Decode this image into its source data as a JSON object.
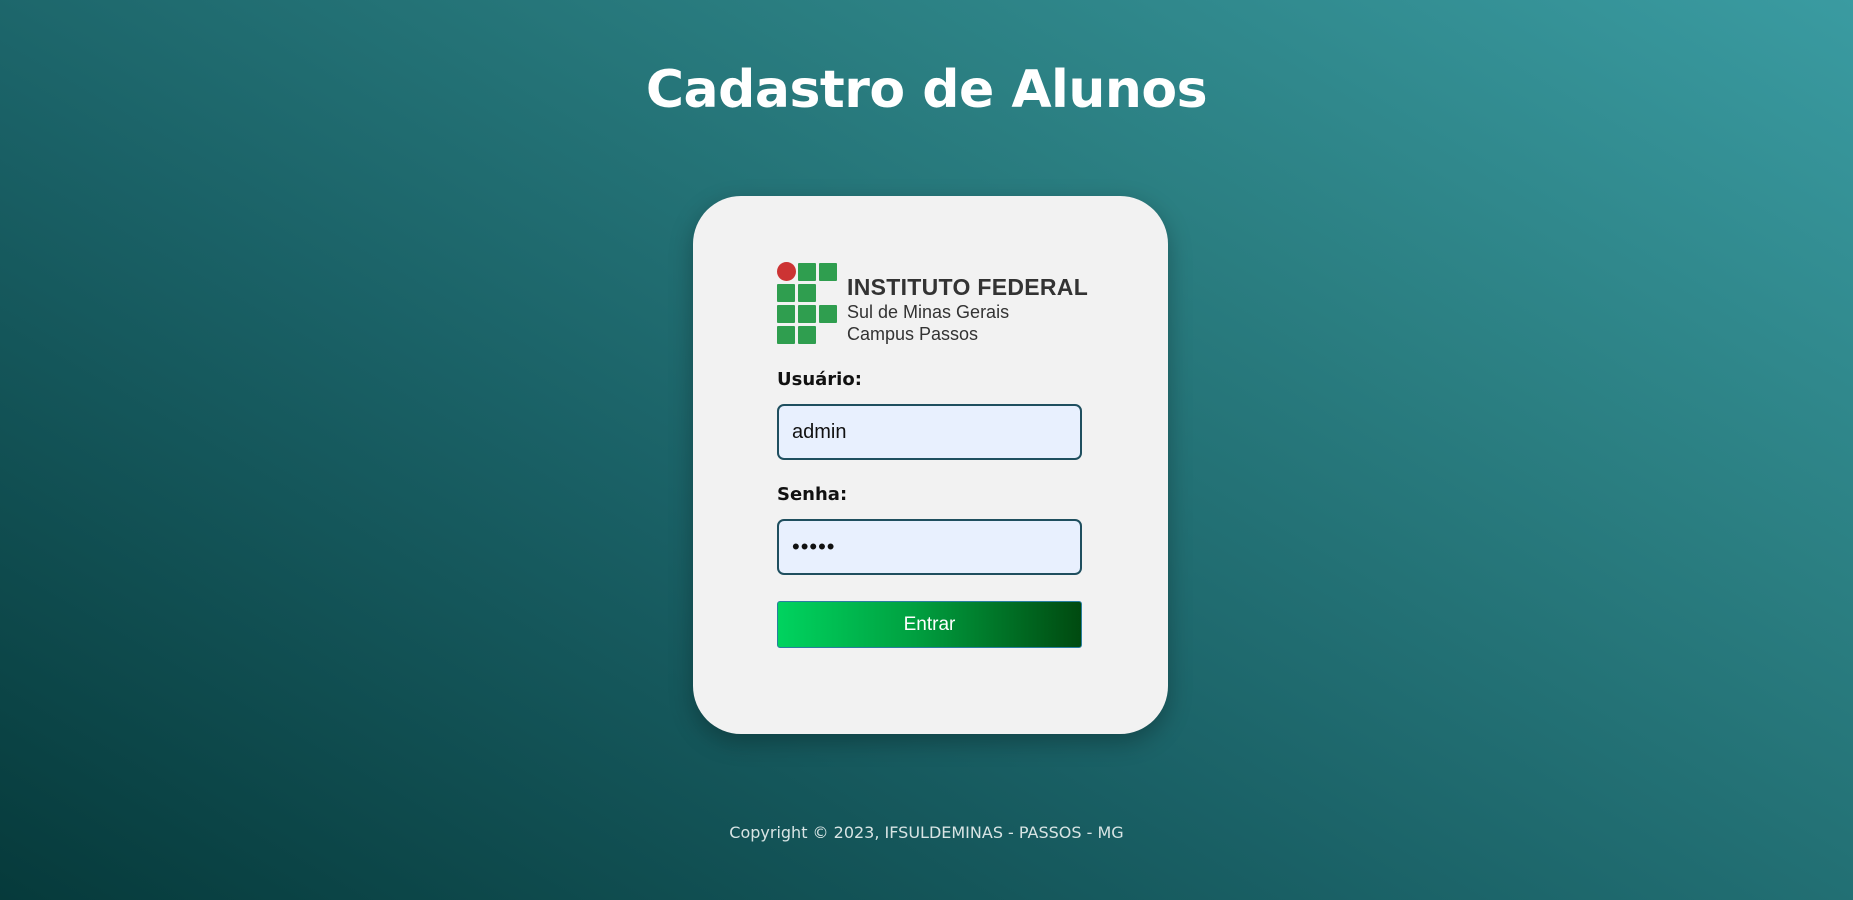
{
  "header": {
    "title": "Cadastro de Alunos"
  },
  "logo": {
    "line1": "INSTITUTO FEDERAL",
    "line2": "Sul de Minas Gerais",
    "line3": "Campus Passos",
    "icon": "if-logo-grid-icon",
    "colors": {
      "green": "#2f9e4f",
      "red": "#cc3333"
    }
  },
  "form": {
    "username_label": "Usuário:",
    "username_value": "admin",
    "password_label": "Senha:",
    "password_value": "•••••",
    "submit_label": "Entrar"
  },
  "footer": {
    "copyright": "Copyright © 2023, IFSULDEMINAS - PASSOS - MG"
  },
  "colors": {
    "background_dark": "#063a3b",
    "background_light": "#3a9ba1",
    "card": "#f2f2f2",
    "button_start": "#00d35f",
    "button_end": "#004a10",
    "input_bg": "#e8f0fe",
    "input_border": "#1f4f5f"
  }
}
